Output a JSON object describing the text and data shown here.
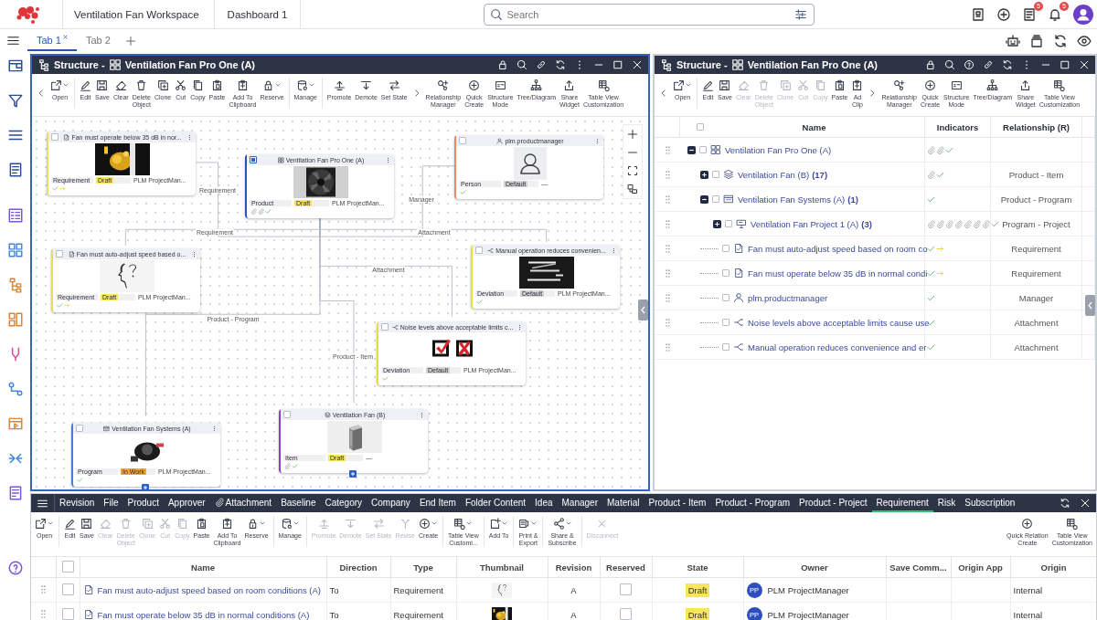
{
  "app": {
    "workspace": "Ventilation Fan Workspace",
    "dashboard": "Dashboard 1",
    "search": {
      "placeholder": "Search"
    },
    "notifications": [
      {
        "count": "5"
      },
      {
        "count": "5"
      }
    ]
  },
  "tabs": [
    {
      "label": "Tab 1",
      "selected": true,
      "closable": true
    },
    {
      "label": "Tab 2",
      "selected": false,
      "closable": false
    }
  ],
  "structure_panel": {
    "title": "Structure -",
    "object": "Ventilation Fan Pro One (A)",
    "active": true,
    "toolbar": [
      {
        "kind": "prev"
      },
      {
        "kind": "open",
        "label": "Open",
        "menu": true,
        "disabled": false
      },
      {
        "kind": "separator"
      },
      {
        "kind": "edit",
        "label": "Edit",
        "disabled": false
      },
      {
        "kind": "save",
        "label": "Save",
        "disabled": false
      },
      {
        "kind": "clear",
        "label": "Clear",
        "disabled": false
      },
      {
        "kind": "delete",
        "label": "Delete\nObject",
        "disabled": false
      },
      {
        "kind": "clone",
        "label": "Clone",
        "disabled": false
      },
      {
        "kind": "cut",
        "label": "Cut",
        "disabled": false
      },
      {
        "kind": "copy",
        "label": "Copy",
        "disabled": false
      },
      {
        "kind": "paste",
        "label": "Paste",
        "disabled": false
      },
      {
        "kind": "clipboard",
        "label": "Add To\nClipboard",
        "disabled": false
      },
      {
        "kind": "reserve",
        "label": "Reserve",
        "menu": true,
        "disabled": false
      },
      {
        "kind": "separator"
      },
      {
        "kind": "manage",
        "label": "Manage",
        "menu": true,
        "disabled": false
      },
      {
        "kind": "separator"
      },
      {
        "kind": "promote",
        "label": "Promote",
        "disabled": false
      },
      {
        "kind": "demote",
        "label": "Demote",
        "disabled": false
      },
      {
        "kind": "setstate",
        "label": "Set State",
        "disabled": false
      },
      {
        "kind": "next"
      },
      {
        "kind": "relmgr",
        "label": "Relationship\nManager",
        "disabled": false
      },
      {
        "kind": "quick",
        "label": "Quick\nCreate",
        "disabled": false
      },
      {
        "kind": "structmode",
        "label": "Structure\nMode",
        "disabled": false
      },
      {
        "kind": "tree",
        "label": "Tree/Diagram",
        "disabled": false
      },
      {
        "kind": "share",
        "label": "Share\nWidget",
        "disabled": false
      },
      {
        "kind": "tableview",
        "label": "Table View\nCustomization",
        "disabled": false
      }
    ],
    "diagram": {
      "nodes": [
        {
          "kind": "requirement",
          "title": "Fan must operate below 35 dB in nor...",
          "selected": false,
          "color": "#e6dc6a",
          "thumbnail": {
            "kind": "picture"
          },
          "type_label": "Requirement",
          "state": {
            "label": "Draft",
            "color": "#f7e55b"
          },
          "owner": "PLM ProjectMan...",
          "indicators": [
            {
              "kind": "check"
            },
            {
              "kind": "arrow"
            }
          ]
        },
        {
          "kind": "product",
          "title": "Ventilation Fan Pro One (A)",
          "selected": true,
          "color": "#2c4fc0",
          "thumbnail": {
            "kind": "picture"
          },
          "type_label": "Product",
          "state": {
            "label": "Draft",
            "color": "#f7e55b"
          },
          "owner": "PLM ProjectMan...",
          "indicators": [
            {
              "kind": "clip"
            },
            {
              "kind": "clip"
            },
            {
              "kind": "check"
            }
          ]
        },
        {
          "kind": "person",
          "title": "plm.productmanager",
          "selected": false,
          "color": "#f08a5d",
          "thumbnail": {
            "kind": "avatar"
          },
          "type_label": "Person",
          "state": {
            "label": "Default",
            "color": "#d2d2d2"
          },
          "owner": "—",
          "indicators": [
            {
              "kind": "check"
            }
          ]
        },
        {
          "kind": "requirement",
          "title": "Fan must auto-adjust speed based o...",
          "selected": false,
          "color": "#e6dc6a",
          "thumbnail": {
            "kind": "picture"
          },
          "type_label": "Requirement",
          "state": {
            "label": "Draft",
            "color": "#f7e55b"
          },
          "owner": "PLM ProjectMan...",
          "indicators": [
            {
              "kind": "check"
            },
            {
              "kind": "arrow"
            }
          ]
        },
        {
          "kind": "deviation",
          "title": "Manual operation reduces convenien...",
          "selected": false,
          "color": "#e4e23c",
          "thumbnail": {
            "kind": "picture"
          },
          "type_label": "Deviation",
          "state": {
            "label": "Default",
            "color": "#d2d2d2"
          },
          "owner": "PLM ProjectMan...",
          "indicators": [
            {
              "kind": "check"
            }
          ]
        },
        {
          "kind": "deviation",
          "title": "Noise levels above acceptable limits c...",
          "selected": false,
          "color": "#e4e23c",
          "thumbnail": {
            "kind": "picture"
          },
          "type_label": "Deviation",
          "state": {
            "label": "Default",
            "color": "#d2d2d2"
          },
          "owner": "PLM ProjectMan...",
          "indicators": [
            {
              "kind": "check"
            }
          ]
        },
        {
          "kind": "program",
          "title": "Ventilation Fan Systems (A)",
          "selected": false,
          "color": "#3b82e0",
          "thumbnail": {
            "kind": "picture"
          },
          "type_label": "Program",
          "state": {
            "label": "In Work",
            "color": "#f5a43a"
          },
          "owner": "PLM ProjectMan...",
          "indicators": [
            {
              "kind": "check"
            }
          ],
          "expandable": true
        },
        {
          "kind": "item",
          "title": "Ventilation Fan (B)",
          "selected": false,
          "color": "#8a3fd1",
          "thumbnail": {
            "kind": "picture"
          },
          "type_label": "Item",
          "state": {
            "label": "Draft",
            "color": "#f7e55b"
          },
          "owner": "—",
          "indicators": [
            {
              "kind": "clip"
            },
            {
              "kind": "check"
            }
          ],
          "expandable": true
        }
      ],
      "edges": [
        {
          "label": "Requirement"
        },
        {
          "label": "Manager"
        },
        {
          "label": "Requirement"
        },
        {
          "label": "Attachment"
        },
        {
          "label": "Attachment"
        },
        {
          "label": "Product - Program"
        },
        {
          "label": "Product - Item"
        }
      ]
    }
  },
  "table_panel": {
    "title": "Structure -",
    "object": "Ventilation Fan Pro One (A)",
    "active": false,
    "toolbar": [
      {
        "kind": "prev"
      },
      {
        "kind": "open",
        "label": "Open",
        "menu": true,
        "disabled": false
      },
      {
        "kind": "separator"
      },
      {
        "kind": "edit",
        "label": "Edit",
        "disabled": false
      },
      {
        "kind": "save",
        "label": "Save",
        "disabled": false
      },
      {
        "kind": "clear",
        "label": "Clear",
        "disabled": true
      },
      {
        "kind": "delete",
        "label": "Delete\nObject",
        "disabled": true
      },
      {
        "kind": "clone",
        "label": "Clone",
        "disabled": true
      },
      {
        "kind": "cut",
        "label": "Cut",
        "disabled": true
      },
      {
        "kind": "copy",
        "label": "Copy",
        "disabled": true
      },
      {
        "kind": "paste",
        "label": "Paste",
        "disabled": false
      },
      {
        "kind": "clipboard",
        "label": "Ad\nClip",
        "disabled": false
      },
      {
        "kind": "next"
      },
      {
        "kind": "relmgr",
        "label": "Relationship\nManager",
        "disabled": false
      },
      {
        "kind": "quick",
        "label": "Quick\nCreate",
        "disabled": false
      },
      {
        "kind": "structmode",
        "label": "Structure\nMode",
        "disabled": false
      },
      {
        "kind": "tree",
        "label": "Tree/Diagram",
        "disabled": false
      },
      {
        "kind": "share",
        "label": "Share\nWidget",
        "disabled": false
      },
      {
        "kind": "tableview",
        "label": "Table View\nCustomization",
        "disabled": false
      }
    ],
    "table": {
      "columns": [
        "Name",
        "Indicators",
        "Relationship (R)"
      ],
      "all_selected": false,
      "rows": [
        {
          "kind": "product",
          "name": "Ventilation Fan Pro One (A)",
          "selected": false,
          "expanded": true,
          "indicators": [
            {
              "kind": "clip"
            },
            {
              "kind": "clip"
            },
            {
              "kind": "check"
            }
          ],
          "children": [
            {
              "kind": "item",
              "name": "Ventilation Fan (B)",
              "count": "(17)",
              "selected": false,
              "expanded": false,
              "indicators": [
                {
                  "kind": "clip"
                },
                {
                  "kind": "check"
                }
              ],
              "relationship": "Product - Item"
            },
            {
              "kind": "program",
              "name": "Ventilation Fan Systems (A)",
              "count": "(1)",
              "selected": false,
              "expanded": true,
              "indicators": [
                {
                  "kind": "check"
                }
              ],
              "relationship": "Product - Program",
              "children": [
                {
                  "kind": "project",
                  "name": "Ventilation Fan Project 1 (A)",
                  "count": "(3)",
                  "selected": false,
                  "expanded": false,
                  "indicators": [
                    {
                      "kind": "clip"
                    },
                    {
                      "kind": "clip"
                    },
                    {
                      "kind": "clip"
                    },
                    {
                      "kind": "clip"
                    },
                    {
                      "kind": "clip"
                    },
                    {
                      "kind": "clip"
                    },
                    {
                      "kind": "clip"
                    },
                    {
                      "kind": "check"
                    }
                  ],
                  "relationship": "Program - Project"
                }
              ]
            },
            {
              "kind": "requirement",
              "name": "Fan must auto-adjust speed based on room co",
              "selected": false,
              "indicators": [
                {
                  "kind": "check"
                },
                {
                  "kind": "arrow"
                }
              ],
              "relationship": "Requirement"
            },
            {
              "kind": "requirement",
              "name": "Fan must operate below 35 dB in normal condi",
              "selected": false,
              "indicators": [
                {
                  "kind": "check"
                },
                {
                  "kind": "arrow"
                }
              ],
              "relationship": "Requirement"
            },
            {
              "kind": "person",
              "name": "plm.productmanager",
              "selected": false,
              "indicators": [
                {
                  "kind": "check"
                }
              ],
              "relationship": "Manager"
            },
            {
              "kind": "deviation",
              "name": "Noise levels above acceptable limits cause use",
              "selected": false,
              "indicators": [
                {
                  "kind": "check"
                }
              ],
              "relationship": "Attachment"
            },
            {
              "kind": "deviation",
              "name": "Manual operation reduces convenience and er",
              "selected": false,
              "indicators": [
                {
                  "kind": "check"
                }
              ],
              "relationship": "Attachment"
            }
          ]
        }
      ]
    }
  },
  "relations_panel": {
    "nav": [
      {
        "kind": "plain",
        "label": "Revision",
        "selected": false
      },
      {
        "kind": "plain",
        "label": "File",
        "selected": false
      },
      {
        "kind": "plain",
        "label": "Product",
        "selected": false
      },
      {
        "kind": "plain",
        "label": "Approver",
        "selected": false
      },
      {
        "kind": "attachment",
        "label": "Attachment",
        "selected": false
      },
      {
        "kind": "plain",
        "label": "Baseline",
        "selected": false
      },
      {
        "kind": "plain",
        "label": "Category",
        "selected": false
      },
      {
        "kind": "plain",
        "label": "Company",
        "selected": false
      },
      {
        "kind": "plain",
        "label": "End Item",
        "selected": false
      },
      {
        "kind": "plain",
        "label": "Folder Content",
        "selected": false
      },
      {
        "kind": "plain",
        "label": "Idea",
        "selected": false
      },
      {
        "kind": "plain",
        "label": "Manager",
        "selected": false
      },
      {
        "kind": "plain",
        "label": "Material",
        "selected": false
      },
      {
        "kind": "plain",
        "label": "Product - Item",
        "selected": false
      },
      {
        "kind": "plain",
        "label": "Product - Program",
        "selected": false
      },
      {
        "kind": "plain",
        "label": "Product - Project",
        "selected": false
      },
      {
        "kind": "plain",
        "label": "Requirement",
        "selected": true
      },
      {
        "kind": "plain",
        "label": "Risk",
        "selected": false
      },
      {
        "kind": "plain",
        "label": "Subscription",
        "selected": false
      }
    ],
    "toolbar": [
      {
        "kind": "open",
        "label": "Open",
        "menu": true,
        "disabled": false
      },
      {
        "kind": "separator"
      },
      {
        "kind": "edit",
        "label": "Edit",
        "disabled": false
      },
      {
        "kind": "save",
        "label": "Save",
        "disabled": false
      },
      {
        "kind": "clear",
        "label": "Clear",
        "disabled": true
      },
      {
        "kind": "delete",
        "label": "Delete\nObject",
        "disabled": true
      },
      {
        "kind": "clone",
        "label": "Clone",
        "disabled": true
      },
      {
        "kind": "cut",
        "label": "Cut",
        "disabled": true
      },
      {
        "kind": "copy",
        "label": "Copy",
        "disabled": true
      },
      {
        "kind": "paste",
        "label": "Paste",
        "disabled": false
      },
      {
        "kind": "clipboard",
        "label": "Add To\nClipboard",
        "disabled": false
      },
      {
        "kind": "reserve",
        "label": "Reserve",
        "menu": true,
        "disabled": false
      },
      {
        "kind": "separator"
      },
      {
        "kind": "manage",
        "label": "Manage",
        "menu": true,
        "disabled": false
      },
      {
        "kind": "separator"
      },
      {
        "kind": "promote",
        "label": "Promote",
        "disabled": true
      },
      {
        "kind": "demote",
        "label": "Demote",
        "disabled": true
      },
      {
        "kind": "setstate",
        "label": "Set State",
        "disabled": true
      },
      {
        "kind": "revise",
        "label": "Revise",
        "disabled": true
      },
      {
        "kind": "create",
        "label": "Create",
        "menu": true,
        "disabled": false
      },
      {
        "kind": "separator"
      },
      {
        "kind": "tableview",
        "label": "Table View\nCustomi...",
        "menu": true,
        "disabled": false
      },
      {
        "kind": "separator"
      },
      {
        "kind": "addto",
        "label": "Add To",
        "menu": true,
        "disabled": false
      },
      {
        "kind": "separator"
      },
      {
        "kind": "print",
        "label": "Print &\nExport",
        "menu": true,
        "disabled": false
      },
      {
        "kind": "separator"
      },
      {
        "kind": "sharesub",
        "label": "Share &\nSubscribe",
        "menu": true,
        "disabled": false
      },
      {
        "kind": "separator"
      },
      {
        "kind": "disconnect",
        "label": "Disconnect",
        "disabled": true
      }
    ],
    "actions": [
      {
        "kind": "quick",
        "label": "Quick Relation\nCreate",
        "disabled": false
      },
      {
        "kind": "tableview",
        "label": "Table View\nCustomization",
        "disabled": false
      }
    ],
    "table": {
      "columns": [
        "Name",
        "Direction",
        "Type",
        "Thumbnail",
        "Revision",
        "Reserved",
        "State",
        "Owner",
        "Save Comm...",
        "Origin App",
        "Origin"
      ],
      "all_selected": false,
      "rows": [
        {
          "selected": false,
          "name": "Fan must auto-adjust speed based on room conditions (A)",
          "direction": "To",
          "type": "Requirement",
          "revision": "A",
          "reserved": false,
          "state": {
            "label": "Draft",
            "color": "#f7e55b"
          },
          "owner": {
            "initials": "PP",
            "name": "PLM ProjectManager"
          },
          "origin": "Internal"
        },
        {
          "selected": false,
          "name": "Fan must operate below 35 dB in normal conditions (A)",
          "direction": "To",
          "type": "Requirement",
          "revision": "A",
          "reserved": false,
          "state": {
            "label": "Draft",
            "color": "#f7e55b"
          },
          "owner": {
            "initials": "PP",
            "name": "PLM ProjectManager"
          },
          "origin": "Internal"
        }
      ]
    }
  }
}
